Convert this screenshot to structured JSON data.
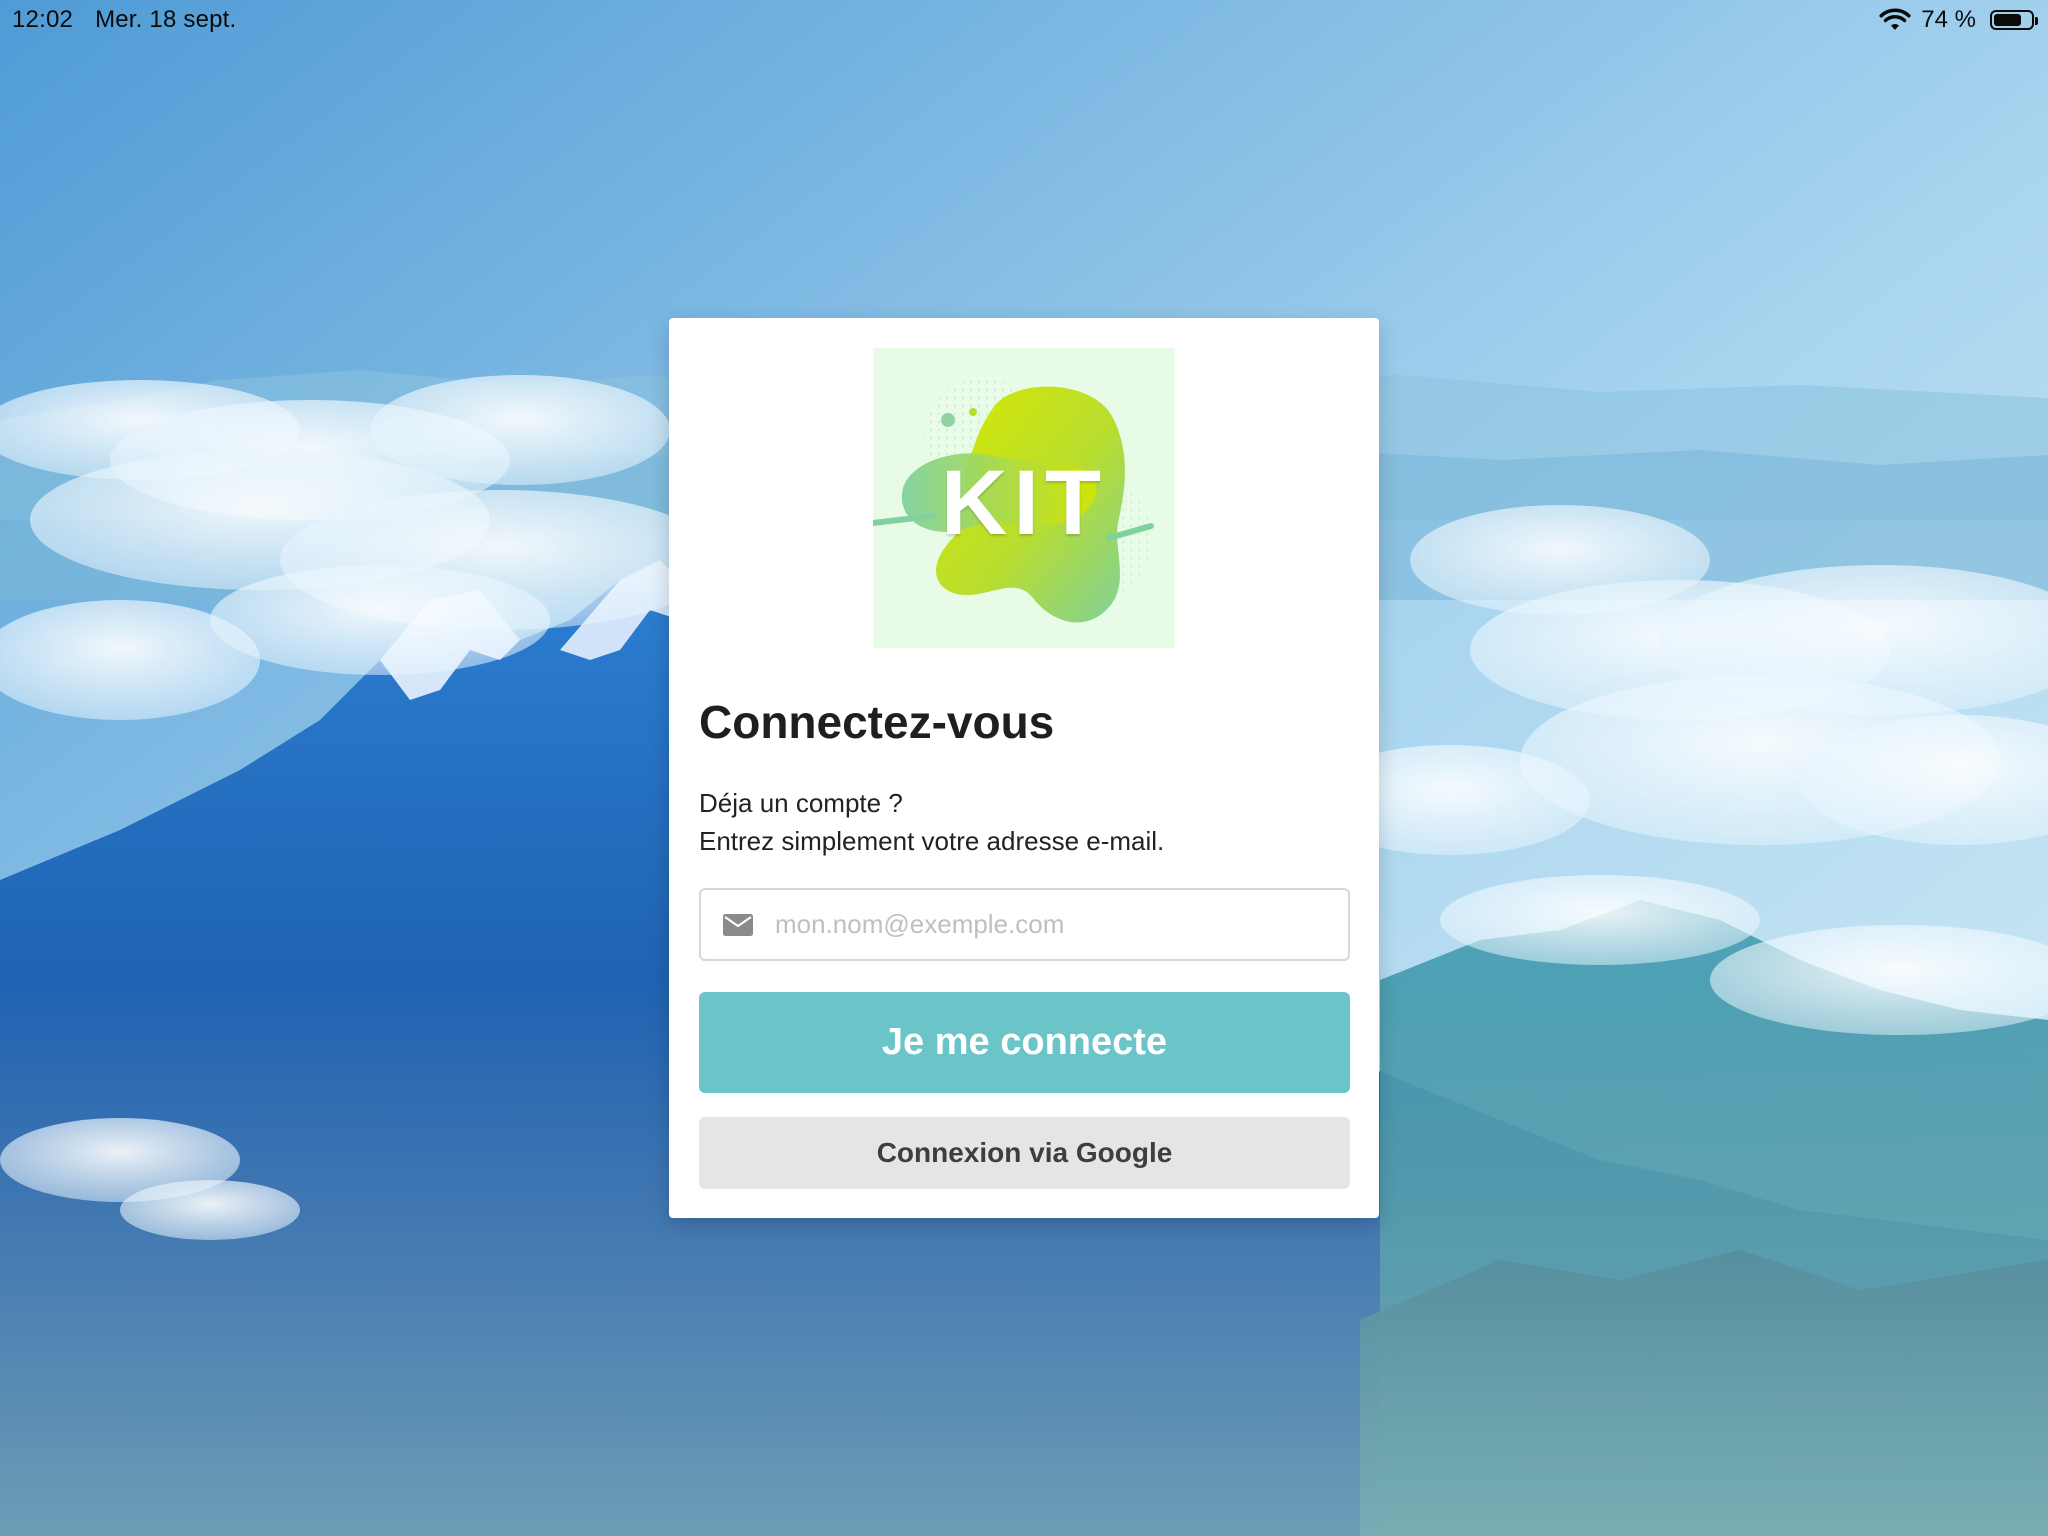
{
  "status_bar": {
    "time": "12:02",
    "date": "Mer. 18 sept.",
    "battery_percent_label": "74 %",
    "battery_level": 0.74,
    "icons": [
      "wifi-icon",
      "battery-icon"
    ]
  },
  "login_card": {
    "logo": {
      "text": "KIT",
      "colors": [
        "#e7fbe7",
        "#d4e600",
        "#7ecf96"
      ]
    },
    "title": "Connectez-vous",
    "subtitle_line1": "Déja un compte ?",
    "subtitle_line2": "Entrez simplement votre adresse e-mail.",
    "email_field": {
      "placeholder": "mon.nom@exemple.com",
      "value": "",
      "icon": "envelope-icon"
    },
    "primary_button_label": "Je me connecte",
    "google_button_label": "Connexion via Google"
  },
  "colors": {
    "primary_button": "#6ac4c8",
    "secondary_button": "#e4e5e7",
    "card_background": "#ffffff"
  }
}
